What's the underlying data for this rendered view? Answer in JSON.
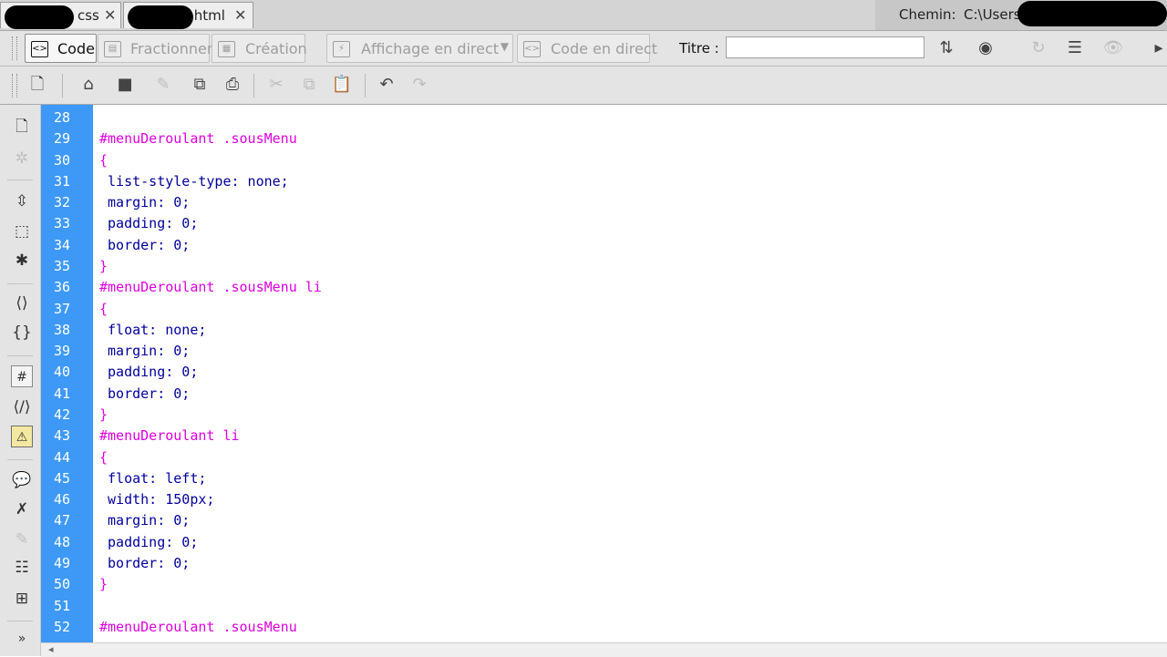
{
  "tabs": [
    {
      "label": "css",
      "close": "✕"
    },
    {
      "label": ".html",
      "close": "✕"
    }
  ],
  "path": {
    "label": "Chemin:",
    "value": "C:\\Users"
  },
  "doc_toolbar": {
    "code": "Code",
    "split": "Fractionner",
    "design": "Création",
    "live_view": "Affichage en direct",
    "live_code": "Code en direct",
    "title_label": "Titre :",
    "title_value": ""
  },
  "icons": {
    "doc_toolbar": [
      "file-management-icon",
      "preview-browser-icon",
      "refresh-icon",
      "view-options-icon",
      "visual-aids-icon"
    ],
    "standard_toolbar": [
      "new-icon",
      "open-icon",
      "browse-bridge-icon",
      "save-icon",
      "save-all-icon",
      "print-icon",
      "cut-icon",
      "copy-icon",
      "paste-icon",
      "undo-icon",
      "redo-icon"
    ],
    "coding_toolbar": [
      "open-documents-icon",
      "show-code-navigator-icon",
      "collapse-tag-icon",
      "collapse-selection-icon",
      "expand-all-icon",
      "select-parent-tag-icon",
      "balance-braces-icon",
      "line-numbers-icon",
      "highlight-invalid-code-icon",
      "syntax-error-alerts-icon",
      "apply-comment-icon",
      "remove-comment-icon",
      "wrap-tag-icon",
      "recent-snippets-icon",
      "move-css-icon",
      "more-icon"
    ]
  },
  "editor": {
    "lines": [
      {
        "n": "28",
        "t": ""
      },
      {
        "n": "29",
        "t": "#menuDeroulant .sousMenu"
      },
      {
        "n": "30",
        "t": "{"
      },
      {
        "n": "31",
        "t": " list-style-type: none;"
      },
      {
        "n": "32",
        "t": " margin: 0;"
      },
      {
        "n": "33",
        "t": " padding: 0;"
      },
      {
        "n": "34",
        "t": " border: 0;"
      },
      {
        "n": "35",
        "t": "}"
      },
      {
        "n": "36",
        "t": "#menuDeroulant .sousMenu li"
      },
      {
        "n": "37",
        "t": "{"
      },
      {
        "n": "38",
        "t": " float: none;"
      },
      {
        "n": "39",
        "t": " margin: 0;"
      },
      {
        "n": "40",
        "t": " padding: 0;"
      },
      {
        "n": "41",
        "t": " border: 0;"
      },
      {
        "n": "42",
        "t": "}"
      },
      {
        "n": "43",
        "t": "#menuDeroulant li"
      },
      {
        "n": "44",
        "t": "{"
      },
      {
        "n": "45",
        "t": " float: left;"
      },
      {
        "n": "46",
        "t": " width: 150px;"
      },
      {
        "n": "47",
        "t": " margin: 0;"
      },
      {
        "n": "48",
        "t": " padding: 0;"
      },
      {
        "n": "49",
        "t": " border: 0;"
      },
      {
        "n": "50",
        "t": "}"
      },
      {
        "n": "51",
        "t": ""
      },
      {
        "n": "52",
        "t": "#menuDeroulant .sousMenu"
      }
    ]
  },
  "colors": {
    "gutter": "#3d99f5",
    "selector": "#dd00dd",
    "property": "#000099"
  }
}
